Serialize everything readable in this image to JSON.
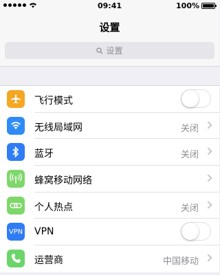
{
  "status_bar": {
    "time": "09:41",
    "battery": "100%"
  },
  "nav": {
    "title": "设置"
  },
  "search": {
    "placeholder": "设置"
  },
  "colors": {
    "airplane": "#f5a623",
    "wifi": "#2f8cf6",
    "bluetooth": "#2f7cf5",
    "cellular": "#7ed76a",
    "hotspot": "#7ed76a",
    "vpn": "#2f7cf5",
    "carrier": "#6bd56b"
  },
  "settings": [
    {
      "icon": "airplane-icon",
      "label": "飞行模式",
      "control": "toggle",
      "value": "",
      "toggle_on": false
    },
    {
      "icon": "wifi-icon",
      "label": "无线局域网",
      "control": "value",
      "value": "关闭"
    },
    {
      "icon": "bluetooth-icon",
      "label": "蓝牙",
      "control": "value",
      "value": "关闭"
    },
    {
      "icon": "cellular-icon",
      "label": "蜂窝移动网络",
      "control": "chevron",
      "value": ""
    },
    {
      "icon": "hotspot-icon",
      "label": "个人热点",
      "control": "value",
      "value": "关闭"
    },
    {
      "icon": "vpn-icon",
      "icon_text": "VPN",
      "label": "VPN",
      "control": "toggle",
      "value": "",
      "toggle_on": false
    },
    {
      "icon": "phone-icon",
      "label": "运营商",
      "control": "value",
      "value": "中国移动"
    }
  ]
}
